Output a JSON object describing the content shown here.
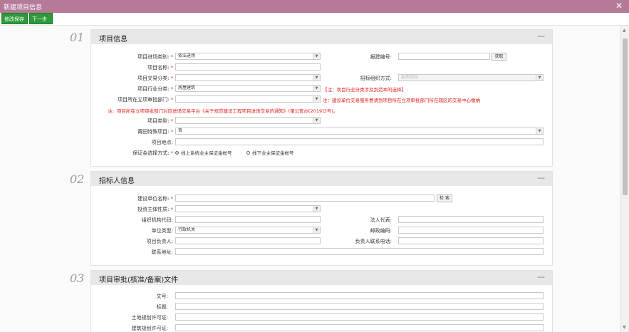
{
  "window": {
    "title": "新建项目信息",
    "close_glyph": "✕"
  },
  "toolbar": {
    "save_label": "修改保存",
    "next_label": "下一步"
  },
  "section1": {
    "number": "01",
    "title": "项目信息",
    "collapse_glyph": "—",
    "entry_type_label": "项目进场类别:",
    "entry_type_value": "依法进场",
    "report_no_label": "报建编号:",
    "fetch_label": "获取",
    "name_label": "项目名称:",
    "trade_class_label": "项目交易分类:",
    "bid_org_label": "招标组织方式:",
    "bid_org_value": "委托招标",
    "industry_label": "项目行业分类:",
    "industry_value": "房屋建筑",
    "industry_note": "【注：项目行业分类涉及到范本的选择】",
    "dept_label": "项目所在立项审批部门:",
    "dept_note": "注：建设单位交易服务费请到项目所在立项审批部门所在辖区的交易中心缴纳",
    "platform_note": "注：项目所在立项审批部门对应进场交易平台《关于规范建设工程项目进场交易的通知》(莆公管办[2019]3号)。",
    "type_label": "项目类型:",
    "special_label": "莆田特殊项目:",
    "special_value": "否",
    "location_label": "项目地点:",
    "deposit_label": "保证金选择方式:",
    "deposit_option1": "线上系统业主保证金帐号",
    "deposit_option2": "线下业主保证金帐号"
  },
  "section2": {
    "number": "02",
    "title": "招标人信息",
    "collapse_glyph": "—",
    "unit_label": "建设单位名称:",
    "search_label": "检 索",
    "investor_label": "投资主体性质:",
    "org_code_label": "组织机构代码:",
    "legal_label": "法人代表:",
    "unit_type_label": "单位类型:",
    "unit_type_value": "行政机关",
    "postcode_label": "邮政编码:",
    "leader_label": "项目负责人:",
    "leader_phone_label": "负责人联系电话:",
    "address_label": "联系地址:"
  },
  "section3": {
    "number": "03",
    "title": "项目审批(核准/备案)文件",
    "collapse_glyph": "—",
    "doc_no_label": "文号:",
    "doc_title_label": "标题:",
    "land_permit_label": "土地规划许可证:",
    "building_permit_label": "建筑规划许可证:"
  },
  "colors": {
    "title_bar": "#b47a98",
    "button_green": "#2e9a3a",
    "required_red": "#e0201c"
  },
  "icons": {
    "select_arrow": "▼",
    "required_mark": "*"
  }
}
